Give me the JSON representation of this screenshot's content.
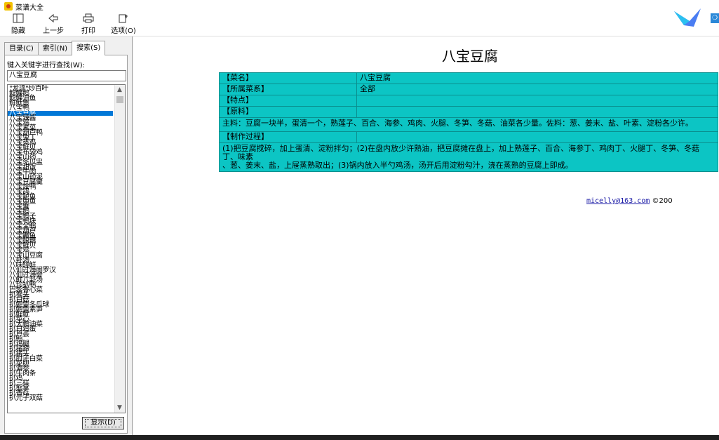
{
  "window": {
    "title": "菜谱大全"
  },
  "toolbar": {
    "hide": "隐藏",
    "back": "上一步",
    "print": "打印",
    "options": "选项(O)"
  },
  "badge": "❍",
  "tabs": {
    "contents": "目录(C)",
    "index": "索引(N)",
    "search": "搜索(S)"
  },
  "prompt": "键入关键字进行查找(W):",
  "search_value": "八宝豆腐",
  "list": [
    "\"龙须\"炒百叶",
    "鲶鲽鹅",
    "鲶鲽油鱼",
    "鲜鱿鱼",
    "八宝鸭",
    "八宝豆腐",
    "八宝辣酱",
    "八宝鸡",
    "八宝素菜",
    "八宝葫芦鸭",
    "八宝兔丁",
    "八宝蒸鸡",
    "八宝鲜贝",
    "八宝布袋鸡",
    "八宝山药",
    "八宝冬瓜盅",
    "八宝甜饭",
    "八宝牛肉",
    "八宝山药泥",
    "八宝豆腐羹",
    "八宝烩鸭",
    "八宝鸽",
    "八宝鲈鱼",
    "八宝甲鱼",
    "八宝蟹",
    "八宝鹅",
    "八宝鸭子",
    "八宝鸭块",
    "八宝全鸭",
    "八宝葫芦",
    "八宝鳜鱼",
    "八宝酿藕",
    "八宝鲜贝",
    "八宝鸡",
    "八宝山豆腐",
    "八卦汤",
    "八味醉鲜",
    "八仙过海闹罗汉",
    "八仙过海会",
    "八鲜八卦汤",
    "八珍扒鸭",
    "巴黎香心菜",
    "扒猴头",
    "扒白菇",
    "扒鲍鱼冬瓜球",
    "扒鲍鱼素笋",
    "扒鲜鱿",
    "扒菜心",
    "扒大鹏油菜",
    "扒白鸡蛋",
    "扒芦荟",
    "扒鸭",
    "扒鸡腿",
    "扒猪蹄",
    "扒猪头",
    "扒肘子白菜",
    "扒菜胆",
    "扒海参",
    "扒牛肉条",
    "扒鸡",
    "扒三样",
    "扒熊掌",
    "扒香菇",
    "扒元子双菇"
  ],
  "selected_item": "八宝豆腐",
  "show_button": "显示(D)",
  "recipe": {
    "title": "八宝豆腐",
    "name_label": "【菜名】",
    "name_value": "八宝豆腐",
    "cuisine_label": "【所属菜系】",
    "cuisine_value": "全部",
    "feature_label": "【特点】",
    "ingredients_label": "【原料】",
    "ingredients_text": "主料：豆腐一块半，蛋清一个，熟莲子、百合、海参、鸡肉、火腿、冬笋、冬菇、油菜各少量。佐料：葱、姜末、盐、叶素、淀粉各少许。",
    "process_label": "【制作过程】",
    "process_text_1": "(1)把豆腐搅碎，加上蛋清、淀粉拌匀；(2)在盘内放少许熟油，把豆腐摊在盘上，加上熟莲子、百合、海参丁、鸡肉丁、火腿丁、冬笋、冬菇丁、味素",
    "process_text_2": "、葱、姜末、盐，上屉蒸熟取出；(3)锅内放入半勺鸡汤，汤开后用淀粉勾汁，浇在蒸熟的豆腐上即成。"
  },
  "footer": {
    "email": "micelly@163.com",
    "copyright": "©200"
  },
  "colors": {
    "table_bg": "#0cc5c4",
    "selection": "#0078d7"
  }
}
